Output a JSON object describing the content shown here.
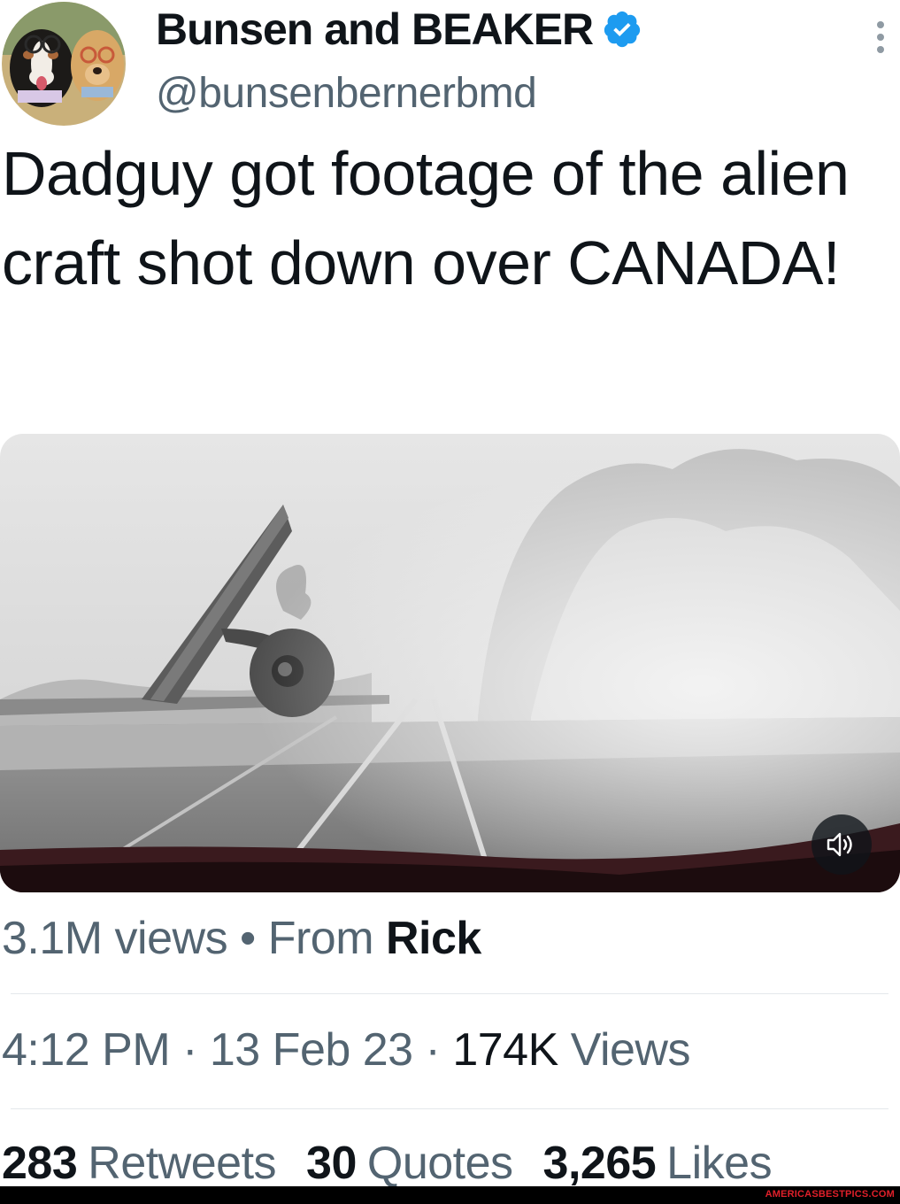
{
  "author": {
    "display_name": "Bunsen and BEAKER",
    "handle": "@bunsenbernerbmd",
    "verified": true,
    "avatar_icon": "dogs-avatar"
  },
  "tweet": {
    "text": "Dadguy got footage of the alien craft shot down over CANADA!"
  },
  "media": {
    "type": "video",
    "mute_icon": "speaker-icon"
  },
  "video_info": {
    "views_label": "3.1M views",
    "separator": "•",
    "from_label": "From",
    "from_name": "Rick"
  },
  "meta": {
    "time": "4:12 PM",
    "date": "13 Feb 23",
    "views_count": "174K",
    "views_label": "Views",
    "separator": "·"
  },
  "stats": {
    "retweets_count": "283",
    "retweets_label": "Retweets",
    "quotes_count": "30",
    "quotes_label": "Quotes",
    "likes_count": "3,265",
    "likes_label": "Likes"
  },
  "watermark": "AMERICASBESTPICS.COM",
  "colors": {
    "text_primary": "#0f1419",
    "text_secondary": "#536471",
    "verified_blue": "#1d9bf0",
    "watermark_red": "#e0202a"
  }
}
